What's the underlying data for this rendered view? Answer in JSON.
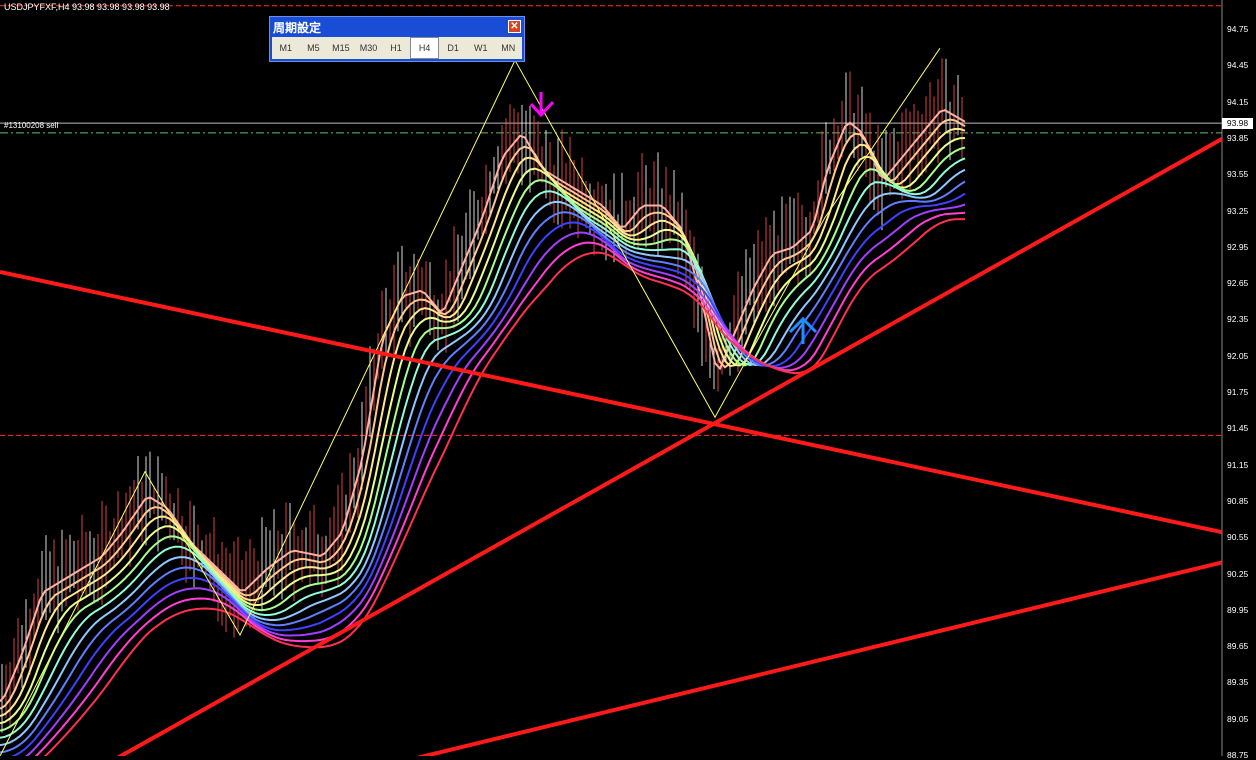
{
  "chart_header": {
    "symbol_info": "USDJPYFXF,H4  93.98 93.98 93.98 93.98"
  },
  "order_label": "#13100208 sell",
  "current_price": "93.98",
  "period_panel": {
    "title": "周期設定",
    "close_icon": "close-icon",
    "buttons": [
      {
        "label": "M1"
      },
      {
        "label": "M5"
      },
      {
        "label": "M15"
      },
      {
        "label": "M30"
      },
      {
        "label": "H1"
      },
      {
        "label": "H4"
      },
      {
        "label": "D1"
      },
      {
        "label": "W1"
      },
      {
        "label": "MN"
      }
    ],
    "active": "H4"
  },
  "annotations": {
    "down_arrow_icon": "down-arrow-icon",
    "up_arrow_icon": "up-arrow-icon"
  },
  "colors": {
    "background": "#000000",
    "trendline": "#ff1a1a",
    "zigzag": "#ffff66",
    "down_arrow": "#ff00ff",
    "up_arrow": "#1e90ff"
  },
  "chart_data": {
    "type": "line",
    "symbol": "USDJPYFXF",
    "timeframe": "H4",
    "ylim": [
      88.75,
      94.75
    ],
    "y_ticks": [
      "94.75",
      "94.45",
      "94.15",
      "93.85",
      "93.55",
      "93.25",
      "92.95",
      "92.65",
      "92.35",
      "92.05",
      "91.75",
      "91.45",
      "91.15",
      "90.85",
      "90.55",
      "90.25",
      "89.95",
      "89.65",
      "89.35",
      "89.05",
      "88.75"
    ],
    "horizontal_levels": [
      {
        "price": 94.95,
        "style": "dashed",
        "color": "#ff3030"
      },
      {
        "price": 93.98,
        "style": "solid",
        "color": "#bbbbbb"
      },
      {
        "price": 93.9,
        "style": "dashdot",
        "color": "#60c060"
      },
      {
        "price": 91.4,
        "style": "dashed",
        "color": "#ff3030"
      }
    ],
    "zigzag": [
      [
        0,
        88.75
      ],
      [
        145,
        91.1
      ],
      [
        240,
        89.75
      ],
      [
        515,
        94.5
      ],
      [
        715,
        91.55
      ],
      [
        825,
        93.2
      ],
      [
        940,
        94.6
      ]
    ],
    "close_path": [
      [
        0,
        89.2
      ],
      [
        20,
        89.6
      ],
      [
        40,
        90.1
      ],
      [
        60,
        90.2
      ],
      [
        80,
        90.3
      ],
      [
        100,
        90.4
      ],
      [
        120,
        90.6
      ],
      [
        145,
        90.9
      ],
      [
        165,
        90.8
      ],
      [
        190,
        90.5
      ],
      [
        215,
        90.3
      ],
      [
        240,
        90.1
      ],
      [
        265,
        90.3
      ],
      [
        290,
        90.45
      ],
      [
        320,
        90.4
      ],
      [
        340,
        90.6
      ],
      [
        360,
        91.2
      ],
      [
        380,
        92.2
      ],
      [
        400,
        92.55
      ],
      [
        420,
        92.6
      ],
      [
        440,
        92.4
      ],
      [
        460,
        92.8
      ],
      [
        480,
        93.2
      ],
      [
        500,
        93.7
      ],
      [
        520,
        93.9
      ],
      [
        540,
        93.6
      ],
      [
        560,
        93.5
      ],
      [
        580,
        93.4
      ],
      [
        600,
        93.3
      ],
      [
        620,
        93.1
      ],
      [
        640,
        93.3
      ],
      [
        660,
        93.3
      ],
      [
        680,
        93.1
      ],
      [
        700,
        92.5
      ],
      [
        715,
        91.9
      ],
      [
        730,
        92.2
      ],
      [
        750,
        92.6
      ],
      [
        770,
        92.9
      ],
      [
        790,
        92.95
      ],
      [
        810,
        93.1
      ],
      [
        825,
        93.6
      ],
      [
        845,
        94.0
      ],
      [
        860,
        93.9
      ],
      [
        880,
        93.5
      ],
      [
        900,
        93.7
      ],
      [
        920,
        93.9
      ],
      [
        940,
        94.1
      ],
      [
        965,
        93.98
      ]
    ],
    "trendlines": [
      {
        "x1": 0,
        "y1": 92.75,
        "x2": 1222,
        "y2": 90.6
      },
      {
        "x1": 110,
        "y1": 88.7,
        "x2": 1222,
        "y2": 93.85
      },
      {
        "x1": 400,
        "y1": 88.7,
        "x2": 1222,
        "y2": 90.35
      }
    ],
    "ma_ribbon": {
      "count": 12,
      "colors": [
        "#ffb0a0",
        "#ffc890",
        "#ffe890",
        "#e8ff90",
        "#a8ff90",
        "#90ffd8",
        "#90c8ff",
        "#5f7fff",
        "#4040ff",
        "#a040ff",
        "#ff40d0",
        "#ff3050"
      ]
    }
  }
}
